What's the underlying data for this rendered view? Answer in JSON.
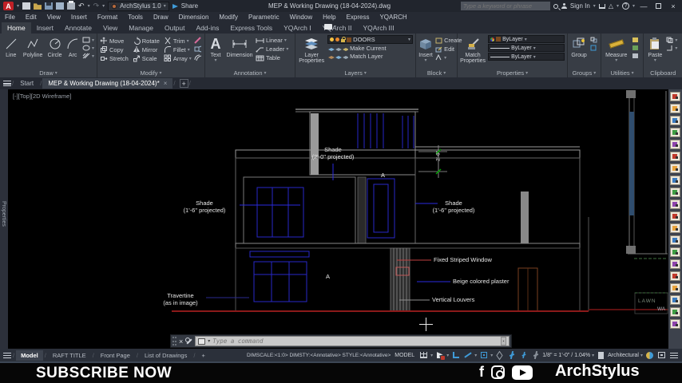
{
  "titlebar": {
    "logo_letter": "A",
    "workspace": "ArchStylus 1.0",
    "share_label": "Share",
    "doc_title": "MEP & Working Drawing (18-04-2024).dwg",
    "search_placeholder": "Type a keyword or phrase",
    "sign_in_label": "Sign In"
  },
  "menubar": {
    "items": [
      "File",
      "Edit",
      "View",
      "Insert",
      "Format",
      "Tools",
      "Draw",
      "Dimension",
      "Modify",
      "Parametric",
      "Window",
      "Help",
      "Express",
      "YQARCH"
    ]
  },
  "ribbon": {
    "tabs": [
      {
        "label": "Home",
        "active": true
      },
      {
        "label": "Insert"
      },
      {
        "label": "Annotate"
      },
      {
        "label": "View"
      },
      {
        "label": "Manage"
      },
      {
        "label": "Output"
      },
      {
        "label": "Add-ins"
      },
      {
        "label": "Express Tools"
      },
      {
        "label": "YQArch I"
      },
      {
        "label": "YQArch II"
      },
      {
        "label": "YQArch III"
      }
    ],
    "panels": {
      "draw": {
        "label": "Draw",
        "tools": [
          "Line",
          "Polyline",
          "Circle",
          "Arc"
        ]
      },
      "modify": {
        "label": "Modify",
        "tools": [
          "Move",
          "Rotate",
          "Trim",
          "Copy",
          "Mirror",
          "Fillet",
          "Stretch",
          "Scale",
          "Array"
        ]
      },
      "annotation": {
        "label": "Annotation",
        "text_tool": "Text",
        "dimension_tool": "Dimension",
        "tools": [
          "Linear",
          "Leader",
          "Table"
        ]
      },
      "layers": {
        "label": "Layers",
        "big": "Layer Properties",
        "current_layer": "DOORS",
        "make_current": "Make Current",
        "match_layer": "Match Layer"
      },
      "block": {
        "label": "Block",
        "big": "Insert",
        "tools": [
          "Create",
          "Edit"
        ]
      },
      "properties": {
        "label": "Properties",
        "big": "Match Properties",
        "color": "ByLayer",
        "lineweight": "ByLayer",
        "linetype": "ByLayer"
      },
      "groups": {
        "label": "Groups",
        "big": "Group"
      },
      "utilities": {
        "label": "Utilities",
        "big": "Measure"
      },
      "clipboard": {
        "label": "Clipboard",
        "big": "Paste"
      }
    }
  },
  "file_tabs": {
    "start": "Start",
    "active": "MEP & Working Drawing (18-04-2024)*"
  },
  "canvas": {
    "viewport_label": "[-][Top][2D Wireframe]",
    "palette_tab": "Properties",
    "labels": {
      "shade_top_1": "Shade",
      "shade_top_2": "(2'-0\" projected)",
      "shade_left_1": "Shade",
      "shade_left_2": "(1'-6\" projected)",
      "shade_right_1": "Shade",
      "shade_right_2": "(1'-6\" projected)",
      "fixed_striped_window": "Fixed Striped Window",
      "beige_plaster": "Beige colored plaster",
      "vertical_louvers": "Vertical Louvers",
      "travertine_1": "Travertine",
      "travertine_2": "(as in image)",
      "grid_a_upper": "A",
      "grid_a_lower": "A",
      "dim_2_6": "2'-6\"",
      "lawn": "LAWN",
      "wa": "WA"
    },
    "command": {
      "placeholder": "Type a command"
    }
  },
  "statusbar": {
    "layout_tabs": [
      {
        "label": "Model",
        "active": true
      },
      {
        "label": "RAFT TITLE"
      },
      {
        "label": "Front Page"
      },
      {
        "label": "List of Drawings"
      }
    ],
    "info": "DIMSCALE:<1:0>  DIMSTY:<Annotative>  STYLE:<Annotative>",
    "model_label": "MODEL",
    "scale": "1/8\" = 1'-0\" / 1.04%",
    "units": "Architectural"
  },
  "banner": {
    "subscribe": "SUBSCRIBE NOW",
    "brand": "ArchStylus"
  },
  "colors": {
    "accent_blue": "#3f9bd8",
    "layer_swatch": "#7a4a20",
    "drawing_blue": "#2626c8",
    "ground_red": "#8b1a1a"
  }
}
